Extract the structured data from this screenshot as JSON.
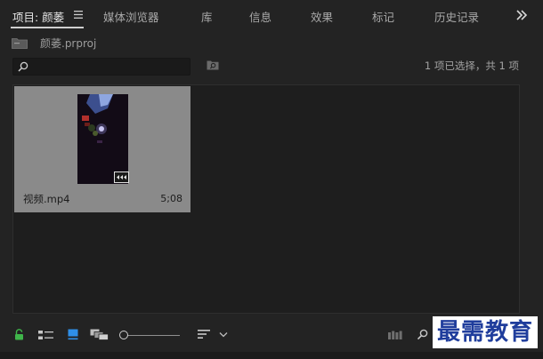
{
  "tabs": [
    {
      "label": "项目: 颜萎",
      "active": true
    },
    {
      "label": "媒体浏览器"
    },
    {
      "label": "库"
    },
    {
      "label": "信息"
    },
    {
      "label": "效果"
    },
    {
      "label": "标记"
    },
    {
      "label": "历史记录"
    }
  ],
  "breadcrumb": {
    "project_file": "颜萎.prproj",
    "icon": "folder-icon"
  },
  "search": {
    "value": "",
    "placeholder": ""
  },
  "status": {
    "selection_text": "1 项已选择，共 1 项"
  },
  "clip": {
    "name": "视频.mp4",
    "duration": "5;08"
  },
  "watermark": {
    "text": "最需教育"
  },
  "colors": {
    "accent_blue": "#2f8fe8",
    "lock_green": "#3fb54a",
    "panel_bg": "#232323",
    "selected_clip_bg": "#8a8a8a"
  },
  "icons": {
    "lock": "lock-icon",
    "list_view": "list-view-icon",
    "icon_view": "icon-view-icon",
    "freeform_view": "freeform-view-icon",
    "sort": "sort-icon",
    "automate": "automate-to-sequence-icon",
    "find": "find-icon",
    "overflow": "chevron-double-right-icon"
  }
}
